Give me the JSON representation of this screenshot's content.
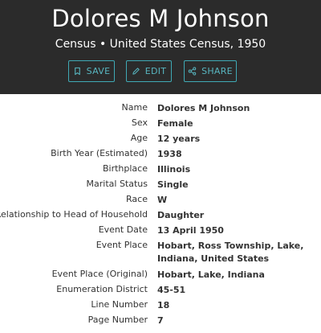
{
  "header": {
    "name": "Dolores M Johnson",
    "subtitle": "Census • United States Census, 1950",
    "actions": [
      {
        "label": "SAVE",
        "icon": "bookmark-icon"
      },
      {
        "label": "EDIT",
        "icon": "pencil-icon"
      },
      {
        "label": "SHARE",
        "icon": "share-icon"
      }
    ],
    "accent_color": "#3fa9b5",
    "background_color": "#2b2b2b"
  },
  "details": [
    {
      "label": "Name",
      "value": "Dolores M Johnson"
    },
    {
      "label": "Sex",
      "value": "Female"
    },
    {
      "label": "Age",
      "value": "12 years"
    },
    {
      "label": "Birth Year (Estimated)",
      "value": "1938"
    },
    {
      "label": "Birthplace",
      "value": "Illinois"
    },
    {
      "label": "Marital Status",
      "value": "Single"
    },
    {
      "label": "Race",
      "value": "W"
    },
    {
      "label": "Relationship to Head of Household",
      "value": "Daughter"
    },
    {
      "label": "Event Date",
      "value": "13 April 1950"
    },
    {
      "label": "Event Place",
      "value": "Hobart, Ross Township, Lake, Indiana, United States"
    },
    {
      "label": "Event Place (Original)",
      "value": "Hobart, Lake, Indiana"
    },
    {
      "label": "Enumeration District",
      "value": "45-51"
    },
    {
      "label": "Line Number",
      "value": "18"
    },
    {
      "label": "Page Number",
      "value": "7"
    }
  ]
}
